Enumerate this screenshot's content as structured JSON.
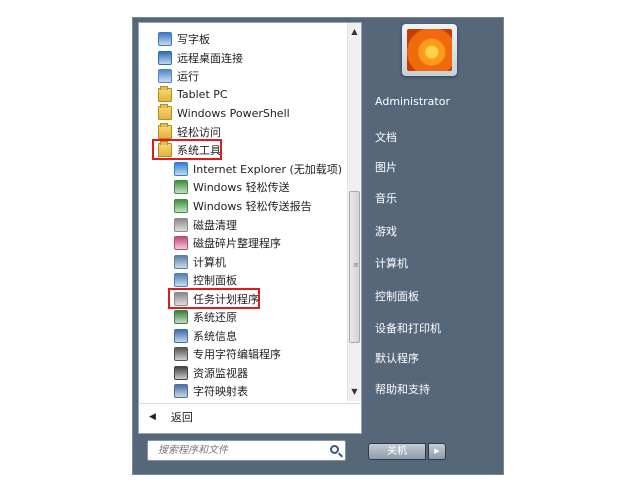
{
  "programs": [
    {
      "label": "写字板",
      "icon": "wordpad-icon",
      "indent": false,
      "color": "#3a78c4"
    },
    {
      "label": "远程桌面连接",
      "icon": "remote-desktop-icon",
      "indent": false,
      "color": "#2d6db5"
    },
    {
      "label": "运行",
      "icon": "run-icon",
      "indent": false,
      "color": "#4f88c9"
    },
    {
      "label": "Tablet PC",
      "icon": "folder-icon",
      "indent": false,
      "color": "#e3b23c"
    },
    {
      "label": "Windows PowerShell",
      "icon": "folder-icon",
      "indent": false,
      "color": "#e3b23c"
    },
    {
      "label": "轻松访问",
      "icon": "folder-icon",
      "indent": false,
      "color": "#e3b23c"
    },
    {
      "label": "系统工具",
      "icon": "folder-icon",
      "indent": false,
      "color": "#e3b23c",
      "highlighted": true
    },
    {
      "label": "Internet Explorer (无加载项)",
      "icon": "internet-explorer-icon",
      "indent": true,
      "color": "#2f7fd6"
    },
    {
      "label": "Windows 轻松传送",
      "icon": "easy-transfer-icon",
      "indent": true,
      "color": "#3d8f3d"
    },
    {
      "label": "Windows 轻松传送报告",
      "icon": "easy-transfer-report-icon",
      "indent": true,
      "color": "#3d8f3d"
    },
    {
      "label": "磁盘清理",
      "icon": "disk-cleanup-icon",
      "indent": true,
      "color": "#8c8c8c"
    },
    {
      "label": "磁盘碎片整理程序",
      "icon": "defragmenter-icon",
      "indent": true,
      "color": "#c04a7a"
    },
    {
      "label": "计算机",
      "icon": "computer-icon",
      "indent": true,
      "color": "#5b7fa6"
    },
    {
      "label": "控制面板",
      "icon": "control-panel-icon",
      "indent": true,
      "color": "#4f7fb8"
    },
    {
      "label": "任务计划程序",
      "icon": "task-scheduler-icon",
      "indent": true,
      "color": "#8a8a8a",
      "highlighted": true
    },
    {
      "label": "系统还原",
      "icon": "system-restore-icon",
      "indent": true,
      "color": "#3b7f3b"
    },
    {
      "label": "系统信息",
      "icon": "system-info-icon",
      "indent": true,
      "color": "#3a6fb0"
    },
    {
      "label": "专用字符编辑程序",
      "icon": "char-editor-icon",
      "indent": true,
      "color": "#555555"
    },
    {
      "label": "资源监视器",
      "icon": "resource-monitor-icon",
      "indent": true,
      "color": "#444444"
    },
    {
      "label": "字符映射表",
      "icon": "char-map-icon",
      "indent": true,
      "color": "#4a6fa5"
    }
  ],
  "back_label": "返回",
  "search": {
    "placeholder": "搜索程序和文件"
  },
  "user_name": "Administrator",
  "right_items": [
    "文档",
    "图片",
    "音乐",
    "游戏",
    "计算机",
    "控制面板",
    "设备和打印机",
    "默认程序",
    "帮助和支持"
  ],
  "shutdown_label": "关机",
  "colors": {
    "highlight": "#e01b1b",
    "right_pane": "#56677a"
  }
}
